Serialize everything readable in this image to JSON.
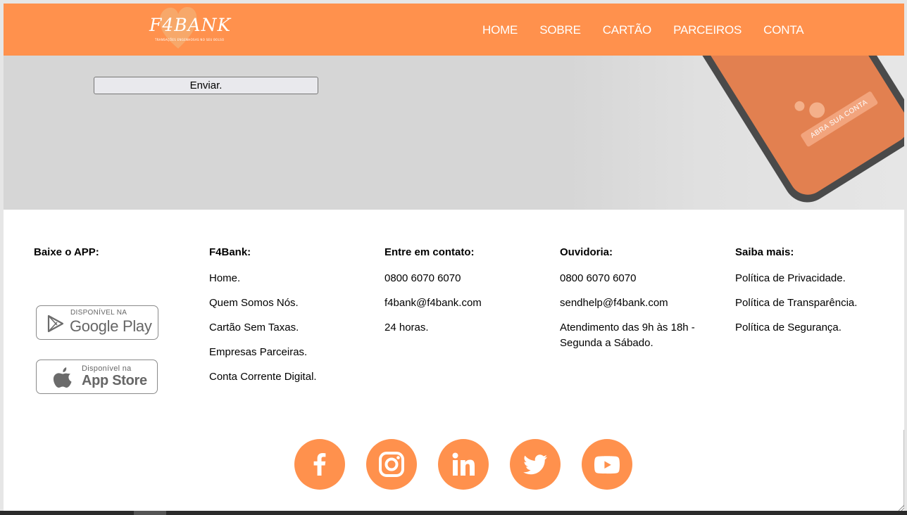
{
  "brand": {
    "name": "F4BANK",
    "tagline": "TRANSAÇÕES ENGENHOSAS NO SEU BOLSO"
  },
  "nav": [
    {
      "label": "HOME"
    },
    {
      "label": "SOBRE"
    },
    {
      "label": "CARTÃO"
    },
    {
      "label": "PARCEIROS"
    },
    {
      "label": "CONTA"
    }
  ],
  "hero": {
    "send_label": "Enviar.",
    "phone_cta": "ABRA SUA CONTA"
  },
  "footer": {
    "app": {
      "title": "Baixe o APP:",
      "google_small": "DISPONÍVEL NA",
      "google_big": "Google Play",
      "apple_small": "Disponível na",
      "apple_big": "App Store"
    },
    "f4bank": {
      "title": "F4Bank:",
      "links": [
        "Home.",
        "Quem Somos Nós.",
        "Cartão Sem Taxas.",
        "Empresas Parceiras.",
        "Conta Corrente Digital."
      ]
    },
    "contato": {
      "title": "Entre em contato:",
      "items": [
        "0800 6070 6070",
        "f4bank@f4bank.com",
        "24 horas."
      ]
    },
    "ouvidoria": {
      "title": "Ouvidoria:",
      "items": [
        "0800 6070 6070",
        "sendhelp@f4bank.com",
        "Atendimento das 9h às 18h - Segunda a Sábado."
      ]
    },
    "saiba": {
      "title": "Saiba mais:",
      "links": [
        "Política de Privacidade.",
        "Política de Transparência.",
        "Política de Segurança."
      ]
    }
  },
  "socials": [
    {
      "icon": "facebook-icon"
    },
    {
      "icon": "instagram-icon"
    },
    {
      "icon": "linkedin-icon"
    },
    {
      "icon": "twitter-icon"
    },
    {
      "icon": "youtube-icon"
    }
  ],
  "colors": {
    "accent": "#ff914d",
    "hero_bg": "#d6d6d6"
  }
}
